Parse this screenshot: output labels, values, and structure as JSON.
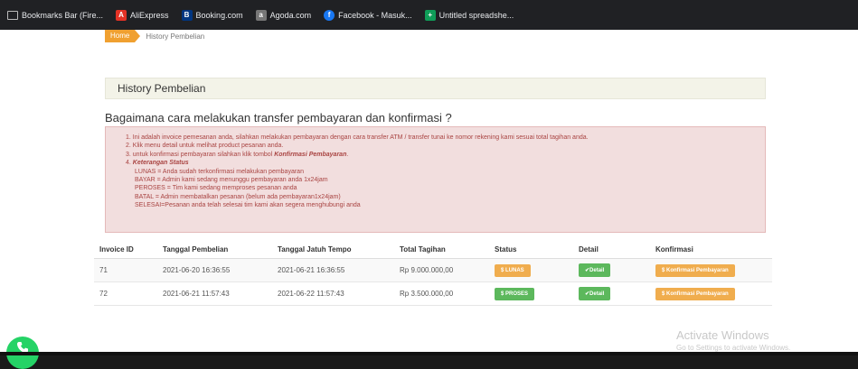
{
  "bookmarks": [
    {
      "label": "Bookmarks Bar (Fire...",
      "icon": "folder-icon"
    },
    {
      "label": "AliExpress",
      "icon": "aliexpress-icon"
    },
    {
      "label": "Booking.com",
      "icon": "booking-icon"
    },
    {
      "label": "Agoda.com",
      "icon": "agoda-icon"
    },
    {
      "label": "Facebook - Masuk...",
      "icon": "facebook-icon"
    },
    {
      "label": "Untitled spreadshe...",
      "icon": "sheets-icon"
    }
  ],
  "breadcrumb": {
    "home": "Home",
    "current": "History Pembelian"
  },
  "panel": {
    "title": "History Pembelian"
  },
  "question": "Bagaimana cara melakukan transfer pembayaran dan konfirmasi ?",
  "instructions": {
    "line1": "1. Ini adalah invoice pemesanan anda, silahkan melakukan pembayaran dengan cara transfer ATM / transfer tunai ke nomor rekening kami sesuai total tagihan anda.",
    "line2": "2. Klik menu detail untuk melihat product pesanan anda.",
    "line3_pre": "3. untuk konfirmasi pembayaran silahkan klik tombol ",
    "line3_bold": "Konfirmasi Pembayaran",
    "line3_post": ".",
    "line4_pre": "4. ",
    "line4_bold": "Keterangan Status",
    "status_lunas": "LUNAS = Anda sudah terkonfirmasi melakukan pembayaran",
    "status_bayar": "BAYAR = Admin kami sedang menunggu pembayaran anda 1x24jam",
    "status_peroses": "PEROSES = Tim kami sedang memproses pesanan anda",
    "status_batal": "BATAL = Admin membatalkan pesanan (belum ada pembayaran1x24jam)",
    "status_selesai": "SELESAI=Pesanan anda telah selesai tim kami akan segera menghubungi anda"
  },
  "table": {
    "headers": {
      "invoice": "Invoice ID",
      "tanggal": "Tanggal Pembelian",
      "jatuh_tempo": "Tanggal Jatuh Tempo",
      "total": "Total Tagihan",
      "status": "Status",
      "detail": "Detail",
      "konfirmasi": "Konfirmasi"
    },
    "rows": [
      {
        "invoice": "71",
        "tanggal": "2021-06-20 16:36:55",
        "jatuh_tempo": "2021-06-21 16:36:55",
        "total": "Rp 9.000.000,00",
        "status": "$ LUNAS",
        "status_color": "#f0ad4e",
        "detail": "✔Detail",
        "konfirmasi": "$ Konfirmasi Pembayaran"
      },
      {
        "invoice": "72",
        "tanggal": "2021-06-21 11:57:43",
        "jatuh_tempo": "2021-06-22 11:57:43",
        "total": "Rp 3.500.000,00",
        "status": "$ PROSES",
        "status_color": "#5cb85c",
        "detail": "✔Detail",
        "konfirmasi": "$ Konfirmasi Pembayaran"
      }
    ]
  },
  "watermark": {
    "title": "Activate Windows",
    "subtitle": "Go to Settings to activate Windows."
  },
  "colors": {
    "accent": "#f0a030",
    "success": "#5cb85c",
    "warning": "#f0ad4e",
    "alert_bg": "#f2dede",
    "alert_text": "#a94442"
  }
}
